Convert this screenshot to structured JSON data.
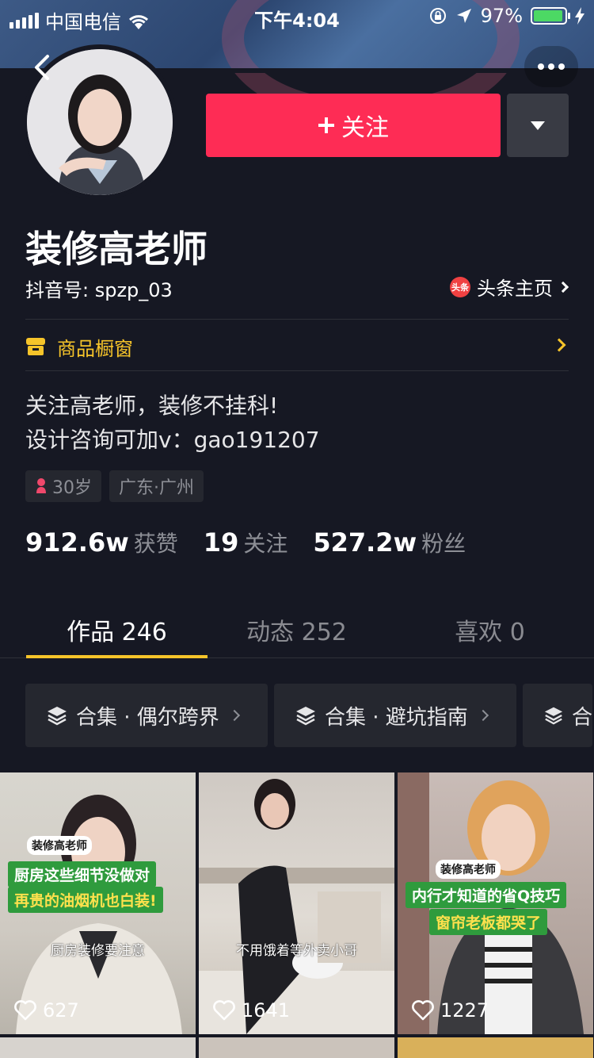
{
  "status_bar": {
    "carrier": "中国电信",
    "time": "下午4:04",
    "battery_percent": "97%",
    "battery_level": 0.97
  },
  "profile": {
    "name": "装修高老师",
    "douyin_id": "抖音号: spzp_03",
    "toutiao_label": "头条主页",
    "toutiao_icon_text": "头条",
    "follow_label": "关注",
    "shop_label": "商品橱窗",
    "bio_line1": "关注高老师，装修不挂科!",
    "bio_line2": "设计咨询可加v：gao191207",
    "tags": {
      "age": "30岁",
      "location": "广东·广州"
    },
    "stats": [
      {
        "num": "912.6w",
        "label": "获赞"
      },
      {
        "num": "19",
        "label": "关注"
      },
      {
        "num": "527.2w",
        "label": "粉丝"
      }
    ]
  },
  "tabs": [
    {
      "label": "作品 246",
      "active": true
    },
    {
      "label": "动态 252",
      "active": false
    },
    {
      "label": "喜欢 0",
      "active": false
    }
  ],
  "collections": [
    {
      "label": "合集 · 偶尔跨界"
    },
    {
      "label": "合集 · 避坑指南"
    },
    {
      "label": "合"
    }
  ],
  "videos": [
    {
      "likes": "627",
      "badge": "装修高老师",
      "caption_line1": "厨房这些细节没做对",
      "caption_line2": "再贵的油烟机也白装!",
      "subtitle": "厨房装修要注意"
    },
    {
      "likes": "1641",
      "subtitle": "不用饿着等外卖小哥"
    },
    {
      "likes": "1227",
      "badge": "装修高老师",
      "caption_line1": "内行才知道的省Q技巧",
      "caption_line2": "窗帘老板都哭了"
    }
  ],
  "colors": {
    "background": "#161823",
    "follow": "#fe2c55",
    "accent_yellow": "#f6c42a",
    "muted_text": "#8d8f96"
  }
}
